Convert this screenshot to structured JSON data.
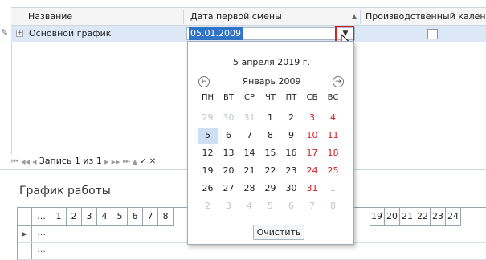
{
  "grid": {
    "columns": [
      "Название",
      "Дата первой смены",
      "Производственный календарь"
    ],
    "row": {
      "name": "Основной график",
      "date": "05.01.2009",
      "checked": false
    }
  },
  "navigator": {
    "first": "⏮",
    "prev_page": "◀◀",
    "prev": "◀",
    "record_text": "Запись 1 из 1",
    "next": "▶",
    "next_page": "▶▶",
    "last": "⏭",
    "add": "▲",
    "apply": "✓",
    "cancel": "✕"
  },
  "calendar": {
    "today_text": "5 апреля 2019 г.",
    "month_title": "Январь 2009",
    "weekdays": [
      "ПН",
      "ВТ",
      "СР",
      "ЧТ",
      "ПТ",
      "СБ",
      "ВС"
    ],
    "weeks": [
      [
        "29",
        "30",
        "31",
        "1",
        "2",
        "3",
        "4"
      ],
      [
        "5",
        "6",
        "7",
        "8",
        "9",
        "10",
        "11"
      ],
      [
        "12",
        "13",
        "14",
        "15",
        "16",
        "17",
        "18"
      ],
      [
        "19",
        "20",
        "21",
        "22",
        "23",
        "24",
        "25"
      ],
      [
        "26",
        "27",
        "28",
        "29",
        "30",
        "31",
        "1"
      ],
      [
        "2",
        "3",
        "4",
        "5",
        "6",
        "7",
        "8"
      ]
    ],
    "other_month": [
      [
        true,
        true,
        true,
        false,
        false,
        false,
        false
      ],
      [
        false,
        false,
        false,
        false,
        false,
        false,
        false
      ],
      [
        false,
        false,
        false,
        false,
        false,
        false,
        false
      ],
      [
        false,
        false,
        false,
        false,
        false,
        false,
        false
      ],
      [
        false,
        false,
        false,
        false,
        false,
        false,
        true
      ],
      [
        true,
        true,
        true,
        true,
        true,
        true,
        true
      ]
    ],
    "selected": "5",
    "clear_label": "Очистить"
  },
  "schedule": {
    "title": "График работы",
    "headers_left": [
      "...",
      "1",
      "2",
      "3",
      "4",
      "5",
      "6",
      "7",
      "8"
    ],
    "headers_right": [
      "19",
      "20",
      "21",
      "22",
      "23",
      "24"
    ],
    "row_dots": "..."
  },
  "colors": {
    "selection": "#dce8f6",
    "accent": "#2f74c6",
    "weekend": "#d22020",
    "highlight_frame": "#c62828"
  }
}
